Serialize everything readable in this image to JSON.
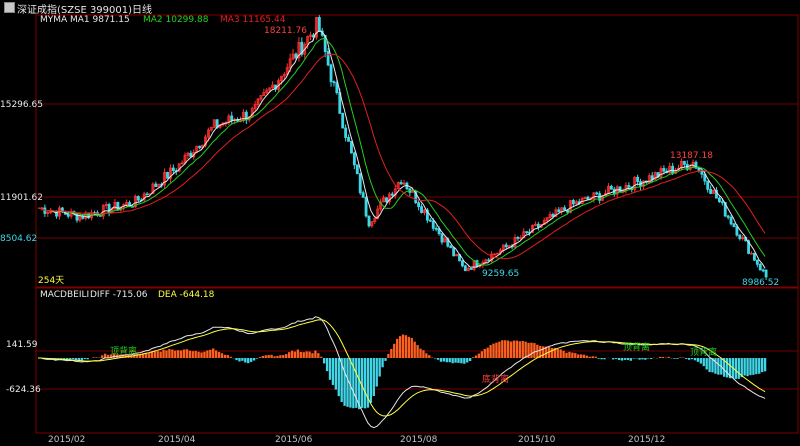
{
  "window": {
    "title": "深证成指(SZSE 399001)日线"
  },
  "colors": {
    "background": "#000000",
    "up": "#ff3030",
    "down": "#3cd8e8",
    "ma1": "#e8e8e8",
    "ma2": "#20d020",
    "ma3": "#e02020",
    "dea": "#ffff40",
    "macd_pos": "#ff6020",
    "macd_neg": "#40d8e8",
    "panel_border": "#800000"
  },
  "price_panel": {
    "legend": [
      {
        "text": "MYMA",
        "color": "#e8e8e8"
      },
      {
        "text": "MA1   9871.15",
        "color": "#e8e8e8"
      },
      {
        "text": "MA2   10299.88",
        "color": "#20d020"
      },
      {
        "text": "MA3   11165.44",
        "color": "#e02020"
      }
    ],
    "y_labels": [
      "15296.65",
      "11901.62",
      "8504.62"
    ],
    "y_values": [
      15296.65,
      11901.62,
      8504.62
    ],
    "annotations": [
      {
        "text": "18211.76",
        "value": 18211.76,
        "color": "#ff4040"
      },
      {
        "text": "13187.18",
        "value": 13187.18,
        "color": "#ff4040"
      },
      {
        "text": "9259.65",
        "value": 9259.65,
        "color": "#40d8e8"
      },
      {
        "text": "8986.52",
        "value": 8986.52,
        "color": "#40d8e8"
      }
    ],
    "period_label": "254天"
  },
  "macd_panel": {
    "legend": [
      {
        "text": "MACDBEILI",
        "color": "#e8e8e8"
      },
      {
        "text": "DIFF   -715.06",
        "color": "#e8e8e8"
      },
      {
        "text": "DEA   -644.18",
        "color": "#ffff40"
      }
    ],
    "y_labels": [
      "141.59",
      "-624.36"
    ],
    "signals": [
      {
        "text": "顶背离",
        "color": "#20d020"
      },
      {
        "text": "底背离",
        "color": "#ff4040"
      },
      {
        "text": "顶背离",
        "color": "#20d020"
      },
      {
        "text": "顶背离",
        "color": "#20d020"
      }
    ]
  },
  "x_labels": [
    "2015/02",
    "2015/04",
    "2015/06",
    "2015/08",
    "2015/10",
    "2015/12"
  ],
  "chart_data": {
    "type": "candlestick",
    "title": "深证成指(SZSE 399001)日线",
    "x_ticks": [
      "2015/02",
      "2015/04",
      "2015/06",
      "2015/08",
      "2015/10",
      "2015/12"
    ],
    "price_keypoints": [
      {
        "date": "2015-01-20",
        "close": 11500
      },
      {
        "date": "2015-02-10",
        "close": 11200
      },
      {
        "date": "2015-03-10",
        "close": 11700
      },
      {
        "date": "2015-04-01",
        "close": 13000
      },
      {
        "date": "2015-04-20",
        "close": 14500
      },
      {
        "date": "2015-05-10",
        "close": 15000
      },
      {
        "date": "2015-06-12",
        "close": 18211.76
      },
      {
        "date": "2015-07-08",
        "close": 11000
      },
      {
        "date": "2015-07-25",
        "close": 12600
      },
      {
        "date": "2015-08-26",
        "close": 9259.65
      },
      {
        "date": "2015-09-15",
        "close": 10000
      },
      {
        "date": "2015-10-20",
        "close": 11600
      },
      {
        "date": "2015-12-22",
        "close": 13187.18
      },
      {
        "date": "2016-01-28",
        "close": 8986.52
      }
    ],
    "moving_averages": [
      {
        "name": "MA1",
        "value": 9871.15
      },
      {
        "name": "MA2",
        "value": 10299.88
      },
      {
        "name": "MA3",
        "value": 11165.44
      }
    ],
    "macd": {
      "DIFF": -715.06,
      "DEA": -644.18,
      "y_ticks": [
        141.59,
        -624.36
      ]
    }
  }
}
